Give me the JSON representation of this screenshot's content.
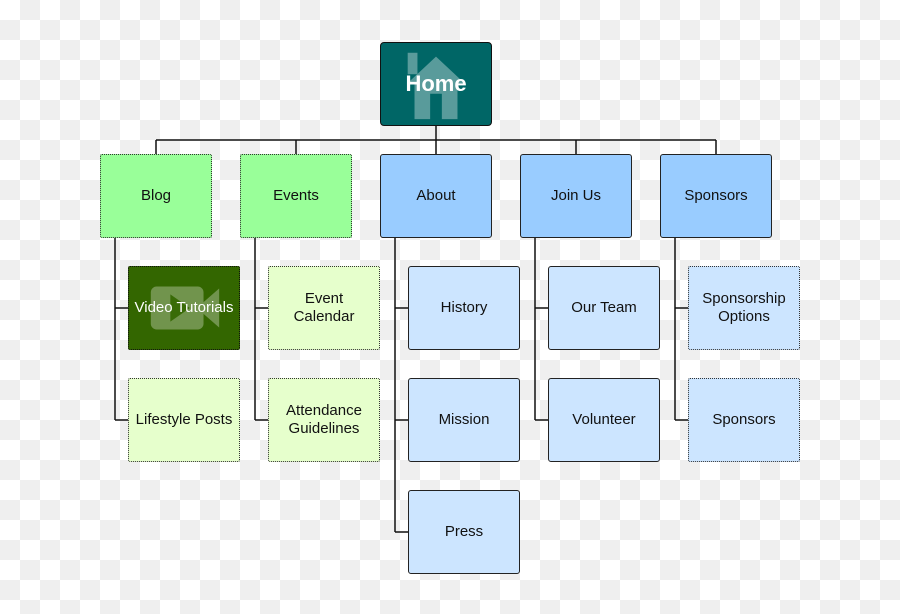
{
  "colors": {
    "home": "#006666",
    "section_green": "#99ff99",
    "child_green": "#e6ffcc",
    "video": "#336600",
    "section_blue": "#99ccff",
    "child_blue": "#cce5ff"
  },
  "root": {
    "label": "Home",
    "icon": "house-icon"
  },
  "sections": [
    {
      "label": "Blog",
      "children": [
        {
          "label": "Video Tutorials",
          "icon": "video-camera-icon"
        },
        {
          "label": "Lifestyle Posts"
        }
      ]
    },
    {
      "label": "Events",
      "children": [
        {
          "label": "Event Calendar"
        },
        {
          "label": "Attendance Guidelines"
        }
      ]
    },
    {
      "label": "About",
      "children": [
        {
          "label": "History"
        },
        {
          "label": "Mission"
        },
        {
          "label": "Press"
        }
      ]
    },
    {
      "label": "Join Us",
      "children": [
        {
          "label": "Our Team"
        },
        {
          "label": "Volunteer"
        }
      ]
    },
    {
      "label": "Sponsors",
      "children": [
        {
          "label": "Sponsorship Options"
        },
        {
          "label": "Sponsors"
        }
      ]
    }
  ]
}
